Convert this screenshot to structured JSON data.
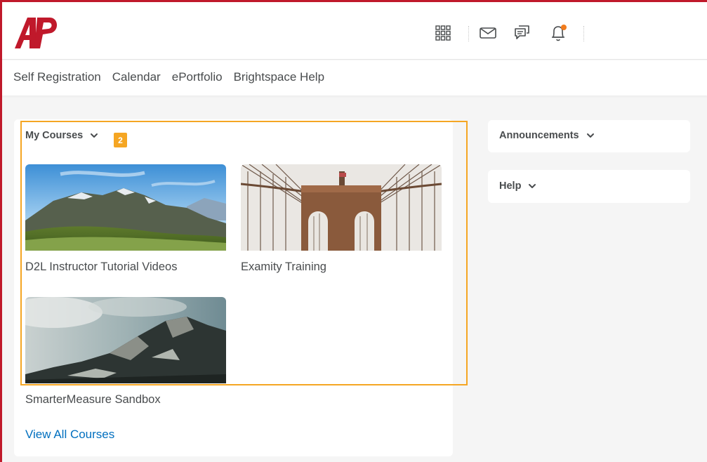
{
  "header": {
    "logo_text": "AP",
    "icons": [
      "waffle-grid-icon",
      "mail-icon",
      "chat-icon",
      "bell-icon"
    ],
    "notification_dot_color": "#f17c1e"
  },
  "nav": {
    "items": [
      "Self Registration",
      "Calendar",
      "ePortfolio",
      "Brightspace Help"
    ]
  },
  "my_courses": {
    "title": "My Courses",
    "badge": "2",
    "courses": [
      {
        "name": "D2L Instructor Tutorial Videos",
        "image": "mountain-valley"
      },
      {
        "name": "Examity Training",
        "image": "bridge-tower"
      },
      {
        "name": "SmarterMeasure Sandbox",
        "image": "rocky-ridge"
      }
    ],
    "view_all": "View All Courses"
  },
  "side_widgets": {
    "announcements": "Announcements",
    "help": "Help"
  },
  "colors": {
    "brand_red": "#c0192b",
    "highlight": "#f5a623",
    "link_blue": "#006fbf"
  }
}
